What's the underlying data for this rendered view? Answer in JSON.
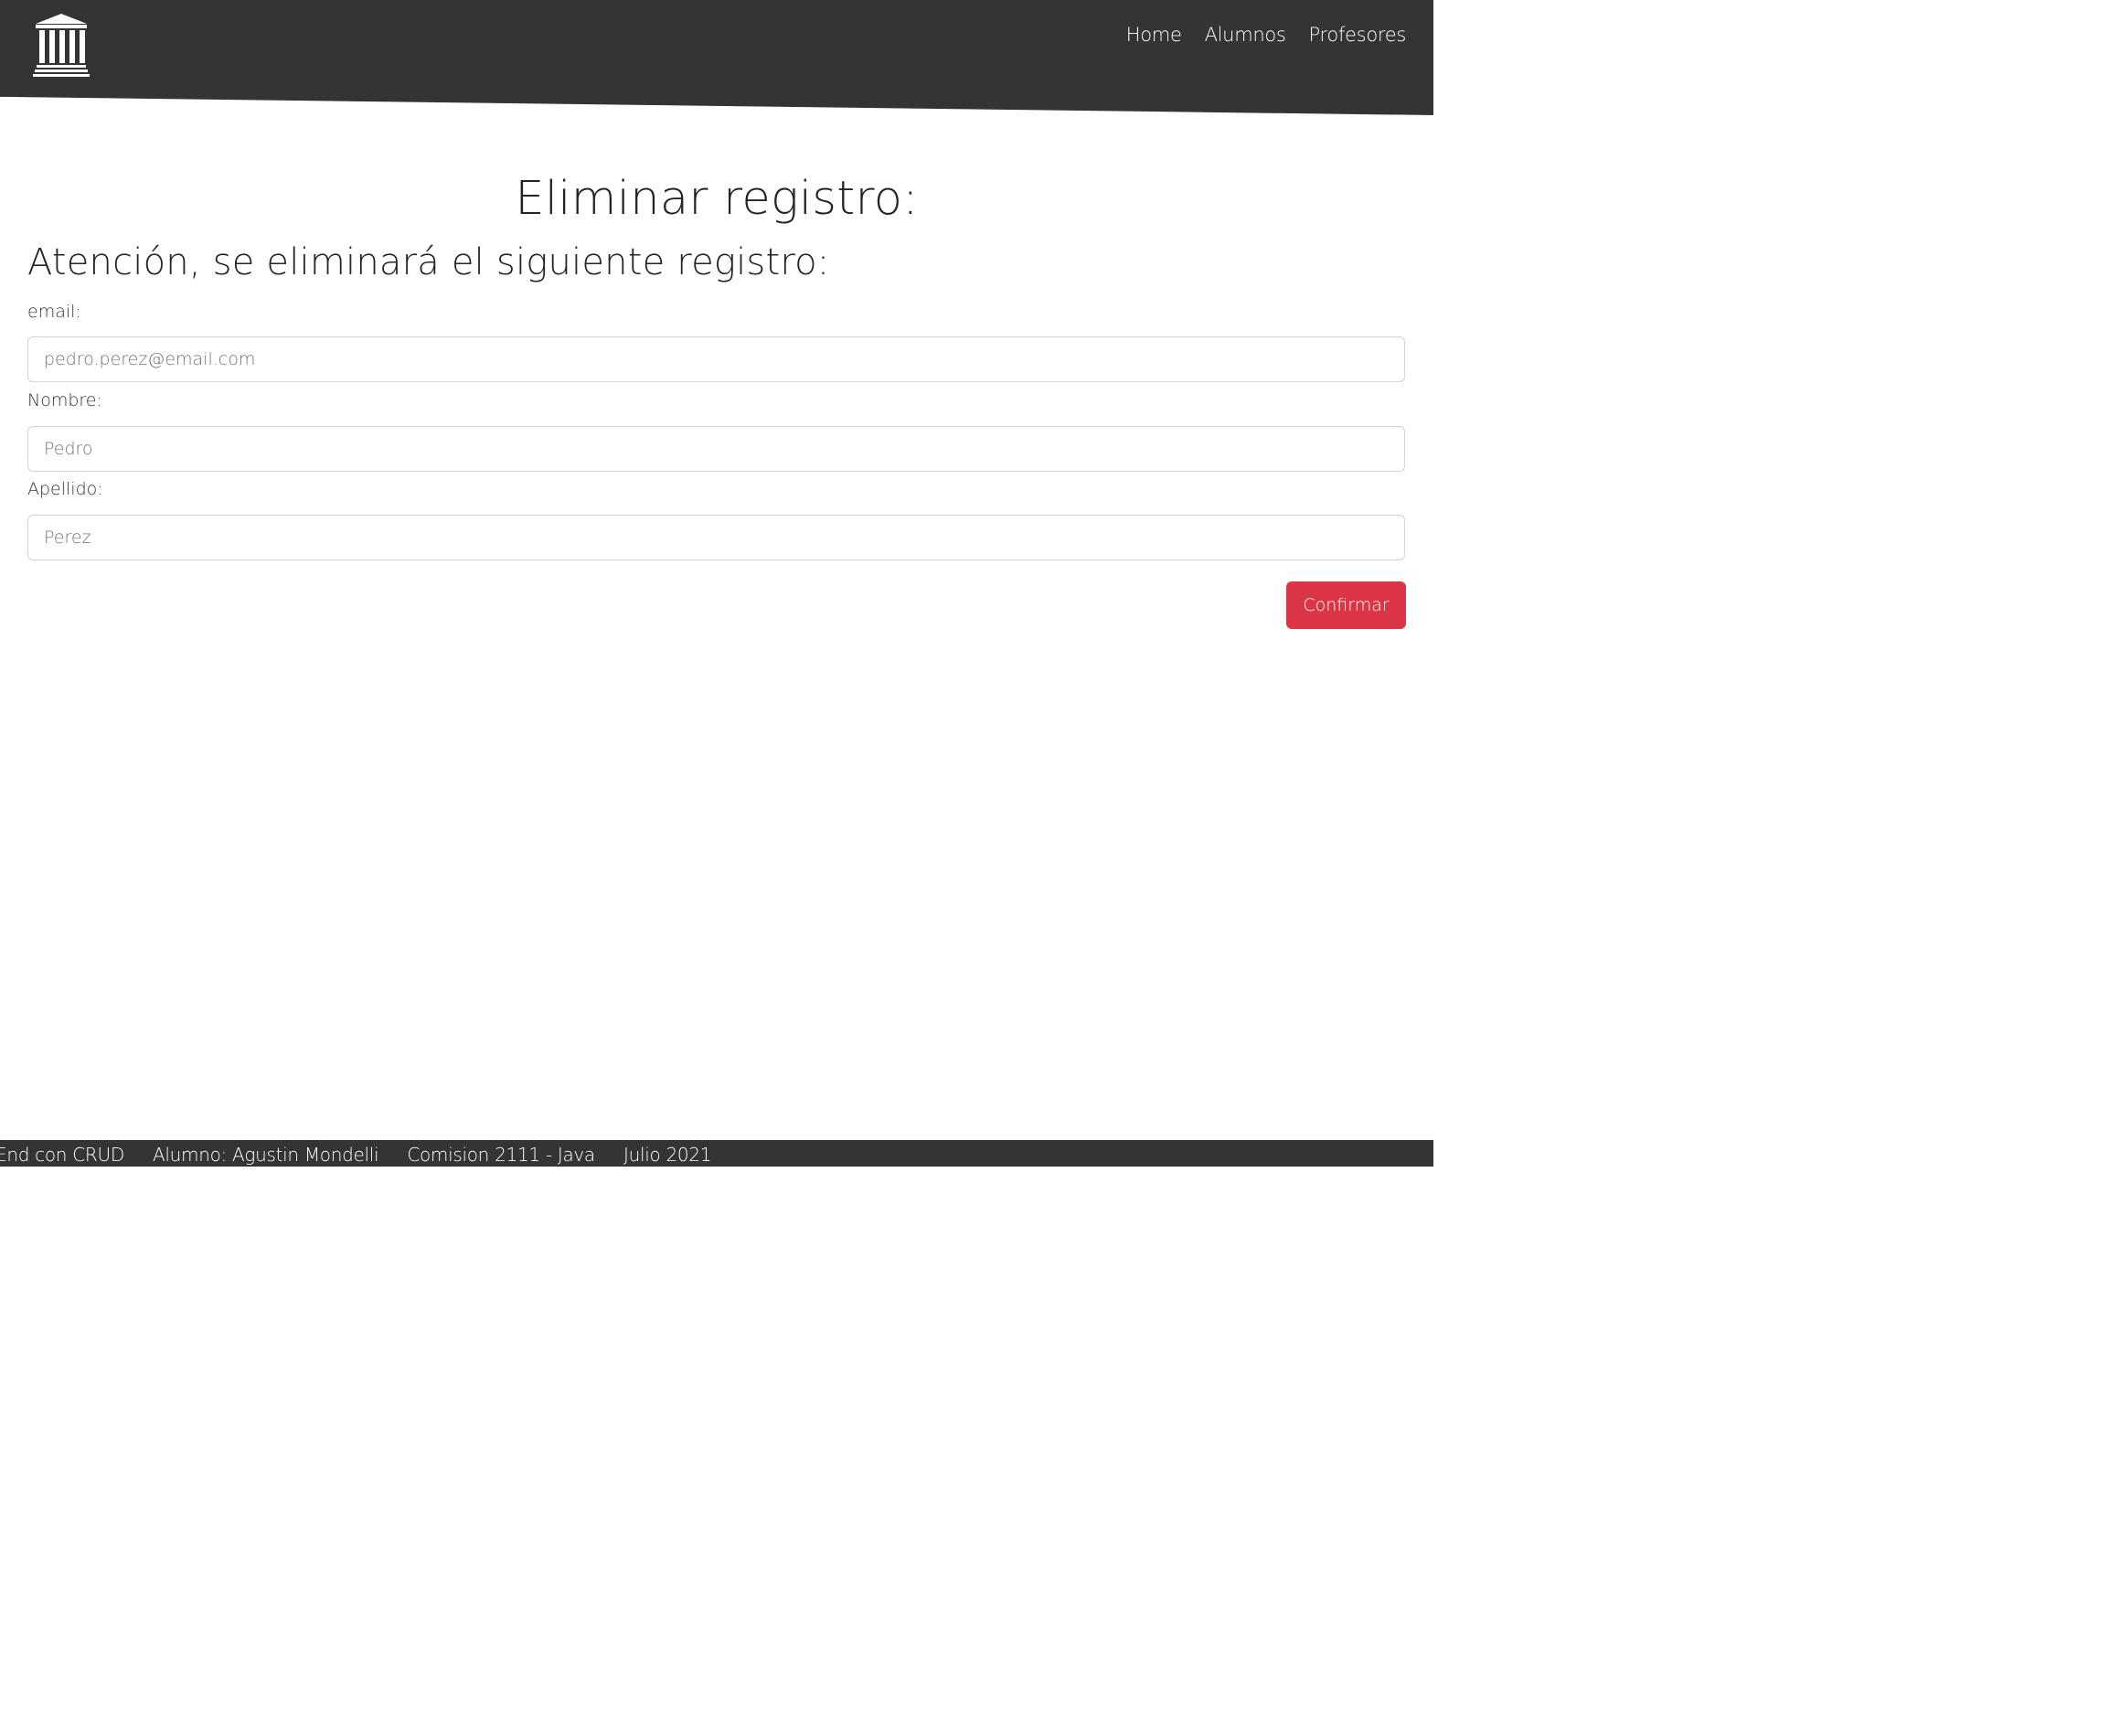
{
  "header": {
    "logo_icon": "institution-building-icon",
    "nav": [
      "Home",
      "Alumnos",
      "Profesores"
    ]
  },
  "main": {
    "title": "Eliminar registro:",
    "warning": "Atención, se eliminará el siguiente registro:",
    "fields": {
      "email": {
        "label": "email:",
        "value": "pedro.perez@email.com"
      },
      "nombre": {
        "label": "Nombre:",
        "value": "Pedro"
      },
      "apellido": {
        "label": "Apellido:",
        "value": "Perez"
      }
    },
    "confirm_button": "Confirmar",
    "confirm_color": "#dc3545"
  },
  "footer": {
    "items": [
      "End con CRUD",
      "Alumno: Agustin Mondelli",
      "Comision 2111 - Java",
      "Julio 2021"
    ]
  },
  "colors": {
    "header_bg": "#343434",
    "footer_bg": "#343434"
  }
}
